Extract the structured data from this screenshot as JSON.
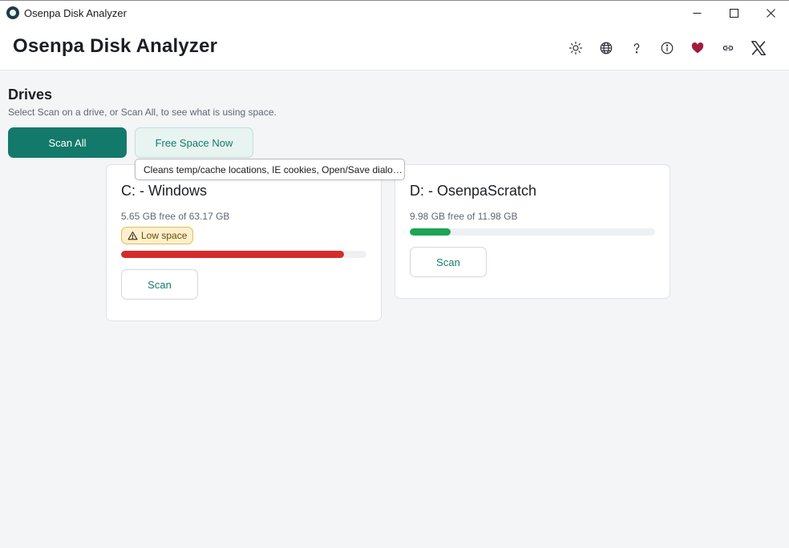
{
  "window": {
    "title": "Osenpa Disk Analyzer",
    "controls": {
      "minimize": "minimize-icon",
      "maximize": "maximize-icon",
      "close": "close-icon"
    }
  },
  "header": {
    "title": "Osenpa Disk Analyzer",
    "icons": [
      "theme-icon",
      "language-icon",
      "help-icon",
      "info-icon",
      "heart-icon",
      "link-icon",
      "x-logo-icon"
    ]
  },
  "drives_section": {
    "title": "Drives",
    "subtitle": "Select Scan on a drive, or Scan All, to see what is using space.",
    "scan_all_label": "Scan All",
    "free_space_label": "Free Space Now",
    "tooltip": "Cleans temp/cache locations, IE cookies, Open/Save dialo…"
  },
  "drives": [
    {
      "title": "C: - Windows",
      "free_text": "5.65 GB free of 63.17 GB",
      "badge": "Low space",
      "used_fraction": 0.91,
      "bar_color": "#d62b2b",
      "scan_label": "Scan"
    },
    {
      "title": "D: - OsenpaScratch",
      "free_text": "9.98 GB free of 11.98 GB",
      "used_fraction": 0.167,
      "bar_color": "#1ea454",
      "scan_label": "Scan"
    }
  ],
  "colors": {
    "accent": "#137a6b",
    "accent_light": "#e8f4f1",
    "warning": "#e9bd4d",
    "danger": "#d62b2b",
    "success": "#1ea454",
    "heart": "#a11c3f"
  }
}
